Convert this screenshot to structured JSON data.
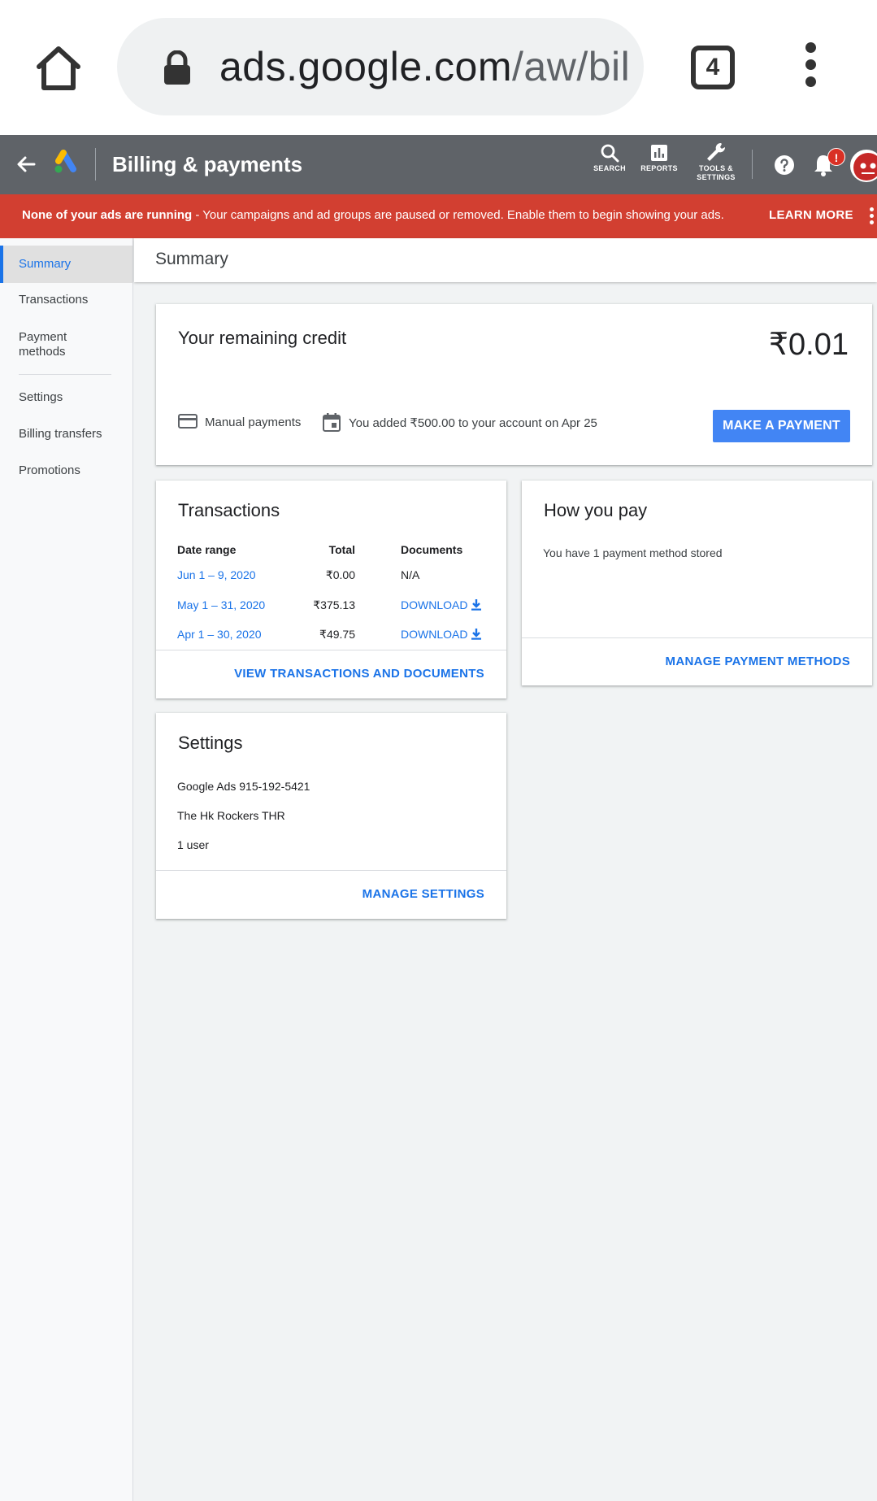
{
  "browser": {
    "url_host": "ads.google.com",
    "url_path": "/aw/bil",
    "tab_count": "4"
  },
  "header": {
    "title": "Billing & payments",
    "tools": {
      "search": "SEARCH",
      "reports": "REPORTS",
      "settings_line1": "TOOLS &",
      "settings_line2": "SETTINGS"
    },
    "notification_badge": "!"
  },
  "alert": {
    "bold": "None of your ads are running",
    "text": " - Your campaigns and ad groups are paused or removed. Enable them to begin showing your ads.",
    "action": "LEARN MORE",
    "color": "#d23f31"
  },
  "sidebar": {
    "items": [
      {
        "label": "Summary"
      },
      {
        "label": "Transactions"
      },
      {
        "label": "Payment"
      },
      {
        "label": "Settings"
      },
      {
        "label": "Billing transfers"
      },
      {
        "label": "Promotions"
      }
    ],
    "payment_line2": "methods"
  },
  "page": {
    "title": "Summary"
  },
  "credit": {
    "title": "Your remaining credit",
    "amount": "₹0.01",
    "payment_type": "Manual payments",
    "last_added": "You added ₹500.00 to your account on Apr 25",
    "button": "MAKE A PAYMENT"
  },
  "transactions": {
    "title": "Transactions",
    "headers": {
      "date": "Date range",
      "total": "Total",
      "docs": "Documents"
    },
    "rows": [
      {
        "date": "Jun 1 – 9, 2020",
        "total": "₹0.00",
        "doc": "N/A"
      },
      {
        "date": "May 1 – 31, 2020",
        "total": "₹375.13",
        "doc": "DOWNLOAD"
      },
      {
        "date": "Apr 1 – 30, 2020",
        "total": "₹49.75",
        "doc": "DOWNLOAD"
      }
    ],
    "action": "VIEW TRANSACTIONS AND DOCUMENTS"
  },
  "how_you_pay": {
    "title": "How you pay",
    "text": "You have 1 payment method stored",
    "action": "MANAGE PAYMENT METHODS"
  },
  "settings": {
    "title": "Settings",
    "account": "Google Ads 915-192-5421",
    "name": "The Hk Rockers THR",
    "users": "1 user",
    "action": "MANAGE SETTINGS"
  },
  "colors": {
    "accent": "#1a73e8",
    "primary_button": "#4285f4",
    "header": "#5f6368"
  }
}
